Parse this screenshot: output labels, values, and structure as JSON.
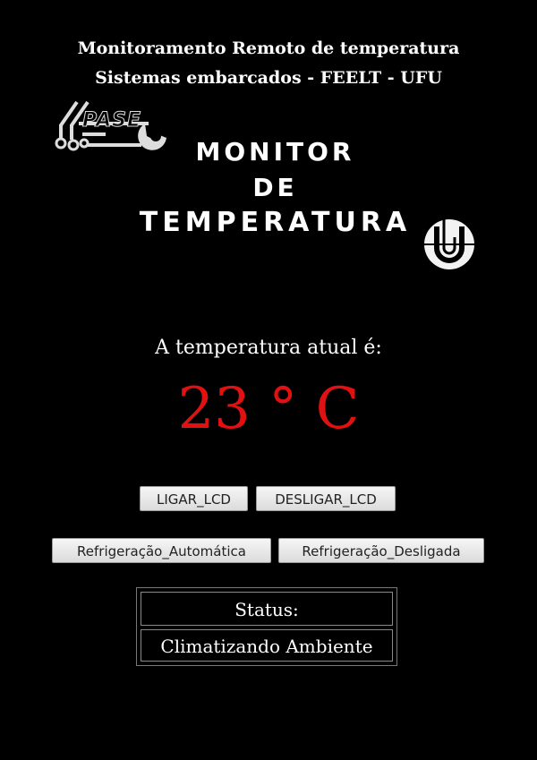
{
  "header": {
    "line1": "Monitoramento Remoto de temperatura",
    "line2": "Sistemas embarcados - FEELT - UFU"
  },
  "logos": {
    "left_logo_text": "PASE",
    "left_logo_icon": "wrench-circuit-icon",
    "right_logo_icon": "ufu-logo-icon"
  },
  "monitor_title": {
    "line1": "MONITOR",
    "line2": "DE",
    "line3": "TEMPERATURA"
  },
  "temperature": {
    "label": "A temperatura atual é:",
    "value": "23 ° C",
    "value_color": "#e11111"
  },
  "buttons": {
    "ligar_lcd": "LIGAR_LCD",
    "desligar_lcd": "DESLIGAR_LCD",
    "refrigeracao_automatica": "Refrigeração_Automática",
    "refrigeracao_desligada": "Refrigeração_Desligada"
  },
  "status": {
    "header": "Status:",
    "value": "Climatizando Ambiente"
  }
}
